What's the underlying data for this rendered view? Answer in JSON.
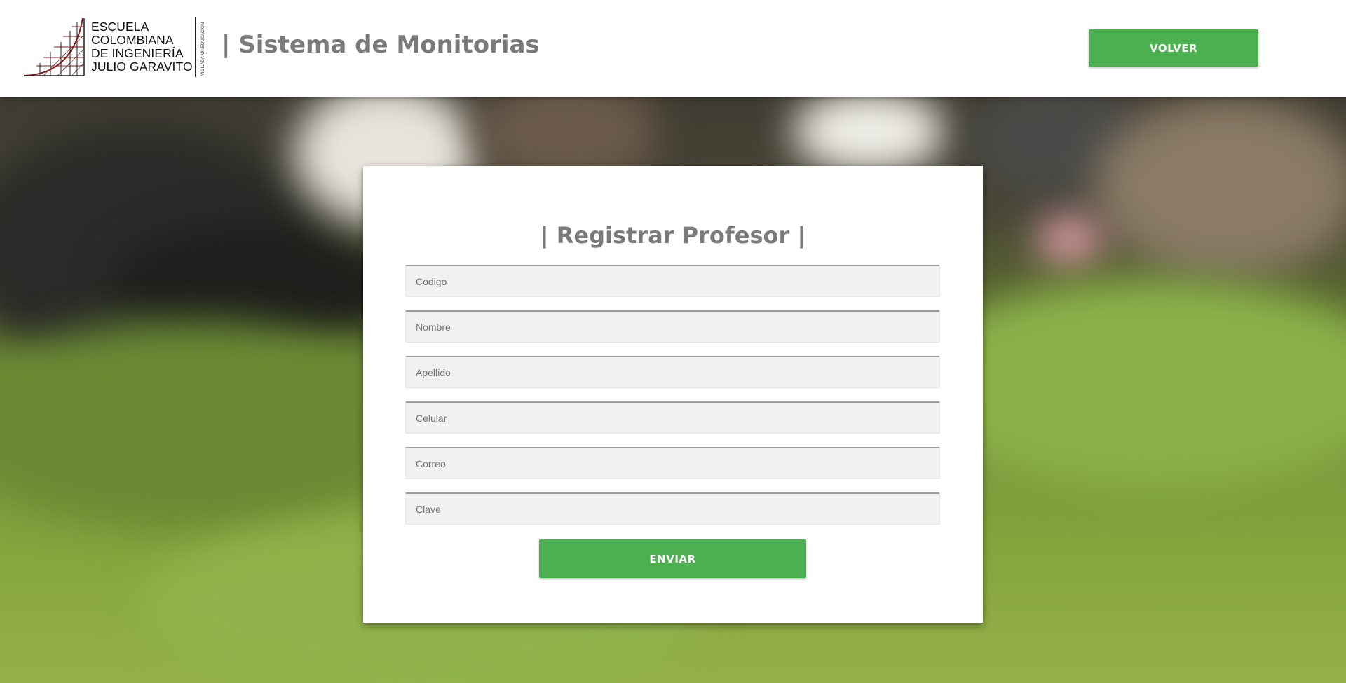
{
  "header": {
    "logo": {
      "lines": [
        "ESCUELA",
        "COLOMBIANA",
        "DE INGENIERÍA",
        "JULIO GARAVITO"
      ],
      "vertical_text": "VIGILADA MINEDUCACIÓN"
    },
    "title": "| Sistema de Monitorias",
    "back_label": "VOLVER"
  },
  "form": {
    "title": "| Registrar Profesor |",
    "fields": [
      {
        "name": "codigo",
        "placeholder": "Codigo",
        "value": ""
      },
      {
        "name": "nombre",
        "placeholder": "Nombre",
        "value": ""
      },
      {
        "name": "apellido",
        "placeholder": "Apellido",
        "value": ""
      },
      {
        "name": "celular",
        "placeholder": "Celular",
        "value": ""
      },
      {
        "name": "correo",
        "placeholder": "Correo",
        "value": ""
      },
      {
        "name": "clave",
        "placeholder": "Clave",
        "value": ""
      }
    ],
    "submit_label": "ENVIAR"
  },
  "colors": {
    "accent": "#4caf50",
    "title_text": "#7a7a7a",
    "logo_red": "#8b1a1a"
  }
}
